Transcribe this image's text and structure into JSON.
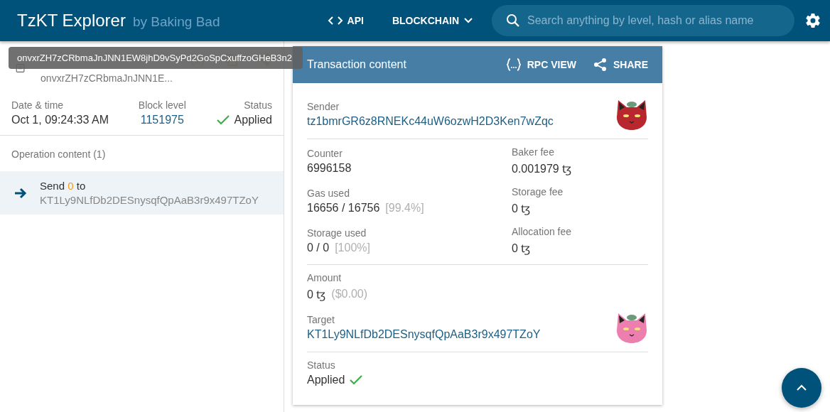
{
  "header": {
    "brand": "TzKT Explorer",
    "byline": "by Baking Bad",
    "nav": [
      {
        "label": "API",
        "kind": "code"
      },
      {
        "label": "BLOCKCHAIN",
        "kind": "dropdown"
      }
    ],
    "search": {
      "placeholder": "Search anything by level, hash or alias name"
    }
  },
  "tooltip": {
    "text": "onvxrZH7zCRbmaJnJNN1EW8jhD9vSyPd2GoSpCxuffzoGHeB3n2"
  },
  "operation": {
    "hash": "onvxrZH7zCRbmaJnJNN1E...",
    "stats": [
      {
        "label": "Date & time",
        "value": "Oct 1, 09:24:33 AM",
        "kind": "text"
      },
      {
        "label": "Block level",
        "value": "1151975",
        "kind": "link"
      },
      {
        "label": "Status",
        "value": "Applied",
        "kind": "status"
      }
    ],
    "content_label": "Operation content (1)",
    "items": [
      {
        "verb": "Send",
        "amount": "0",
        "preposition": "to",
        "target": "KT1Ly9NLfDb2DESnysqfQpAaB3r9x497TZoY",
        "selected": true
      }
    ]
  },
  "transaction": {
    "title": "Transaction content",
    "actions": [
      {
        "label": "RPC VIEW",
        "kind": "code"
      },
      {
        "label": "SHARE",
        "kind": "share"
      }
    ],
    "sections": [
      {
        "fields": [
          {
            "label": "Sender",
            "value": "tz1bmrGR6z8RNEKc44uW6ozwH2D3Ken7wZqc",
            "kind": "link",
            "avatar": {
              "color": "#b8262e"
            }
          }
        ]
      },
      {
        "fields": [
          {
            "label": "Counter",
            "value": "6996158",
            "kind": "text"
          },
          {
            "label": "Baker fee",
            "value": "0.001979 ꜩ",
            "kind": "text"
          },
          {
            "label": "Gas used",
            "value": "16656 / 16756",
            "note": "[99.4%]",
            "kind": "text"
          },
          {
            "label": "Storage fee",
            "value": "0 ꜩ",
            "kind": "text"
          },
          {
            "label": "Storage used",
            "value": "0 / 0",
            "note": "[100%]",
            "kind": "text"
          },
          {
            "label": "Allocation fee",
            "value": "0 ꜩ",
            "kind": "text"
          }
        ]
      },
      {
        "fields": [
          {
            "label": "Amount",
            "value": "0 ꜩ",
            "note": "($0.00)",
            "kind": "text"
          },
          {
            "label": "Target",
            "value": "KT1Ly9NLfDb2DESnysqfQpAaB3r9x497TZoY",
            "kind": "link",
            "avatar": {
              "color": "#ec7fae"
            }
          }
        ]
      },
      {
        "fields": [
          {
            "label": "Status",
            "value": "Applied",
            "kind": "status_after"
          }
        ]
      }
    ]
  }
}
